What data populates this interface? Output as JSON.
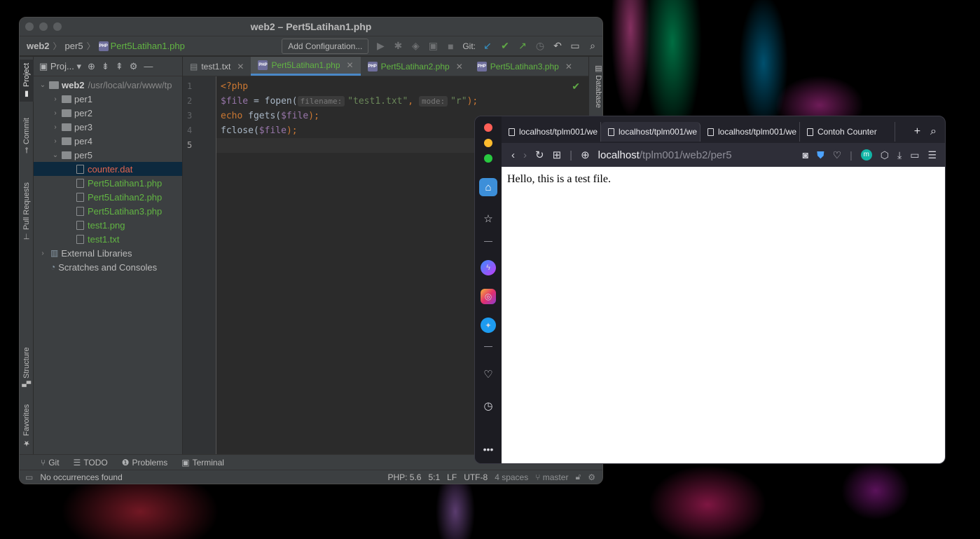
{
  "ide": {
    "title": "web2 – Pert5Latihan1.php",
    "breadcrumb": {
      "project": "web2",
      "folder": "per5",
      "file": "Pert5Latihan1.php"
    },
    "toolbar": {
      "add_config": "Add Configuration...",
      "git_label": "Git:"
    },
    "side_tabs": {
      "project": "Project",
      "commit": "Commit",
      "pull_requests": "Pull Requests",
      "structure": "Structure",
      "favorites": "Favorites",
      "database": "Database"
    },
    "project_panel": {
      "title": "Proj...",
      "root_name": "web2",
      "root_path": "/usr/local/var/www/tp",
      "folders": [
        "per1",
        "per2",
        "per3",
        "per4",
        "per5"
      ],
      "per5_files": [
        {
          "name": "counter.dat",
          "color": "#e0644f"
        },
        {
          "name": "Pert5Latihan1.php",
          "color": "#62b543"
        },
        {
          "name": "Pert5Latihan2.php",
          "color": "#62b543"
        },
        {
          "name": "Pert5Latihan3.php",
          "color": "#62b543"
        },
        {
          "name": "test1.png",
          "color": "#62b543"
        },
        {
          "name": "test1.txt",
          "color": "#62b543"
        }
      ],
      "external_libraries": "External Libraries",
      "scratches": "Scratches and Consoles"
    },
    "tabs": [
      {
        "label": "test1.txt"
      },
      {
        "label": "Pert5Latihan1.php"
      },
      {
        "label": "Pert5Latihan2.php"
      },
      {
        "label": "Pert5Latihan3.php"
      }
    ],
    "code": {
      "line_numbers": [
        "1",
        "2",
        "3",
        "4",
        "5"
      ],
      "l1": "<?php",
      "l2_a": "$file",
      "l2_b": " = fopen(",
      "l2_hint1": "filename:",
      "l2_str1": "\"test1.txt\"",
      "l2_comma": ",",
      "l2_hint2": "mode:",
      "l2_str2": "\"r\"",
      "l2_end": ");",
      "l3_a": "echo",
      "l3_b": " fgets(",
      "l3_var": "$file",
      "l3_end": ");",
      "l4_a": "fclose(",
      "l4_var": "$file",
      "l4_end": ");"
    },
    "bottom_tabs": {
      "git": "Git",
      "todo": "TODO",
      "problems": "Problems",
      "terminal": "Terminal"
    },
    "status": {
      "message": "No occurrences found",
      "php": "PHP: 5.6",
      "position": "5:1",
      "line_sep": "LF",
      "encoding": "UTF-8",
      "indent": "4 spaces",
      "branch": "master"
    }
  },
  "browser": {
    "tabs": [
      {
        "label": "localhost/tplm001/we"
      },
      {
        "label": "localhost/tplm001/we"
      },
      {
        "label": "localhost/tplm001/we"
      },
      {
        "label": "Contoh Counter"
      }
    ],
    "url_host": "localhost",
    "url_path": "/tplm001/web2/per5",
    "avatar_letter": "m",
    "page_text": "Hello, this is a test file."
  }
}
